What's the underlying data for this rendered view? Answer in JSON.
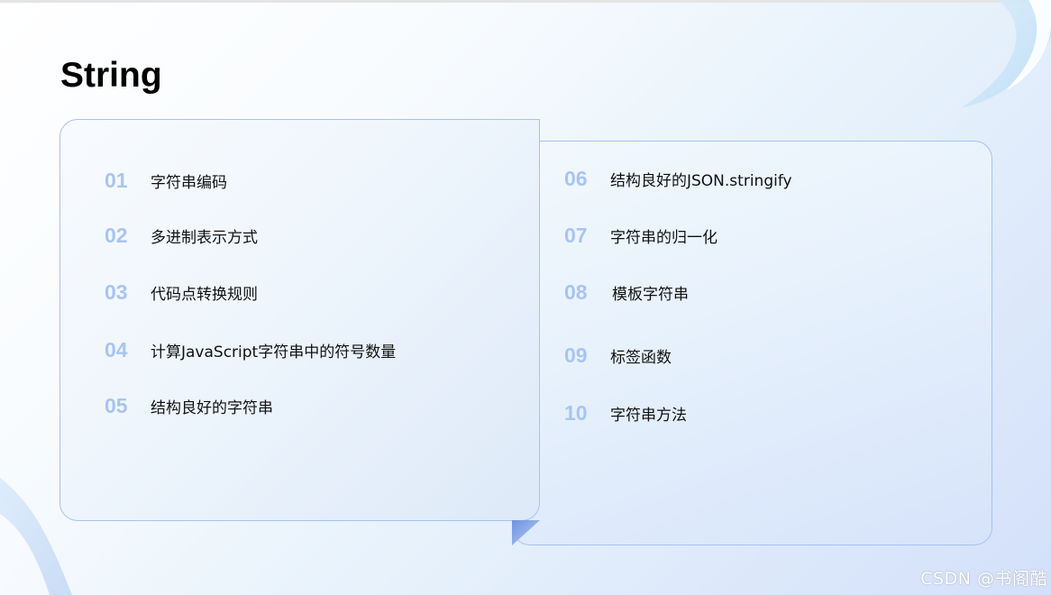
{
  "title": "String",
  "left_list": [
    {
      "number": "01",
      "label": "字符串编码"
    },
    {
      "number": "02",
      "label": "多进制表示方式"
    },
    {
      "number": "03",
      "label": "代码点转换规则"
    },
    {
      "number": "04",
      "label": "计算JavaScript字符串中的符号数量"
    },
    {
      "number": "05",
      "label": "结构良好的字符串"
    }
  ],
  "right_list": [
    {
      "number": "06",
      "label": "结构良好的JSON.stringify"
    },
    {
      "number": "07",
      "label": "字符串的归一化"
    },
    {
      "number": "08",
      "label": "模板字符串"
    },
    {
      "number": "09",
      "label": "标签函数"
    },
    {
      "number": "10",
      "label": "字符串方法"
    }
  ],
  "watermark": "CSDN @书阁酷",
  "colors": {
    "number": "#a8c4f1",
    "card_border": "#a9c1ee",
    "fold": "#8aa9e8",
    "text": "#111111"
  }
}
